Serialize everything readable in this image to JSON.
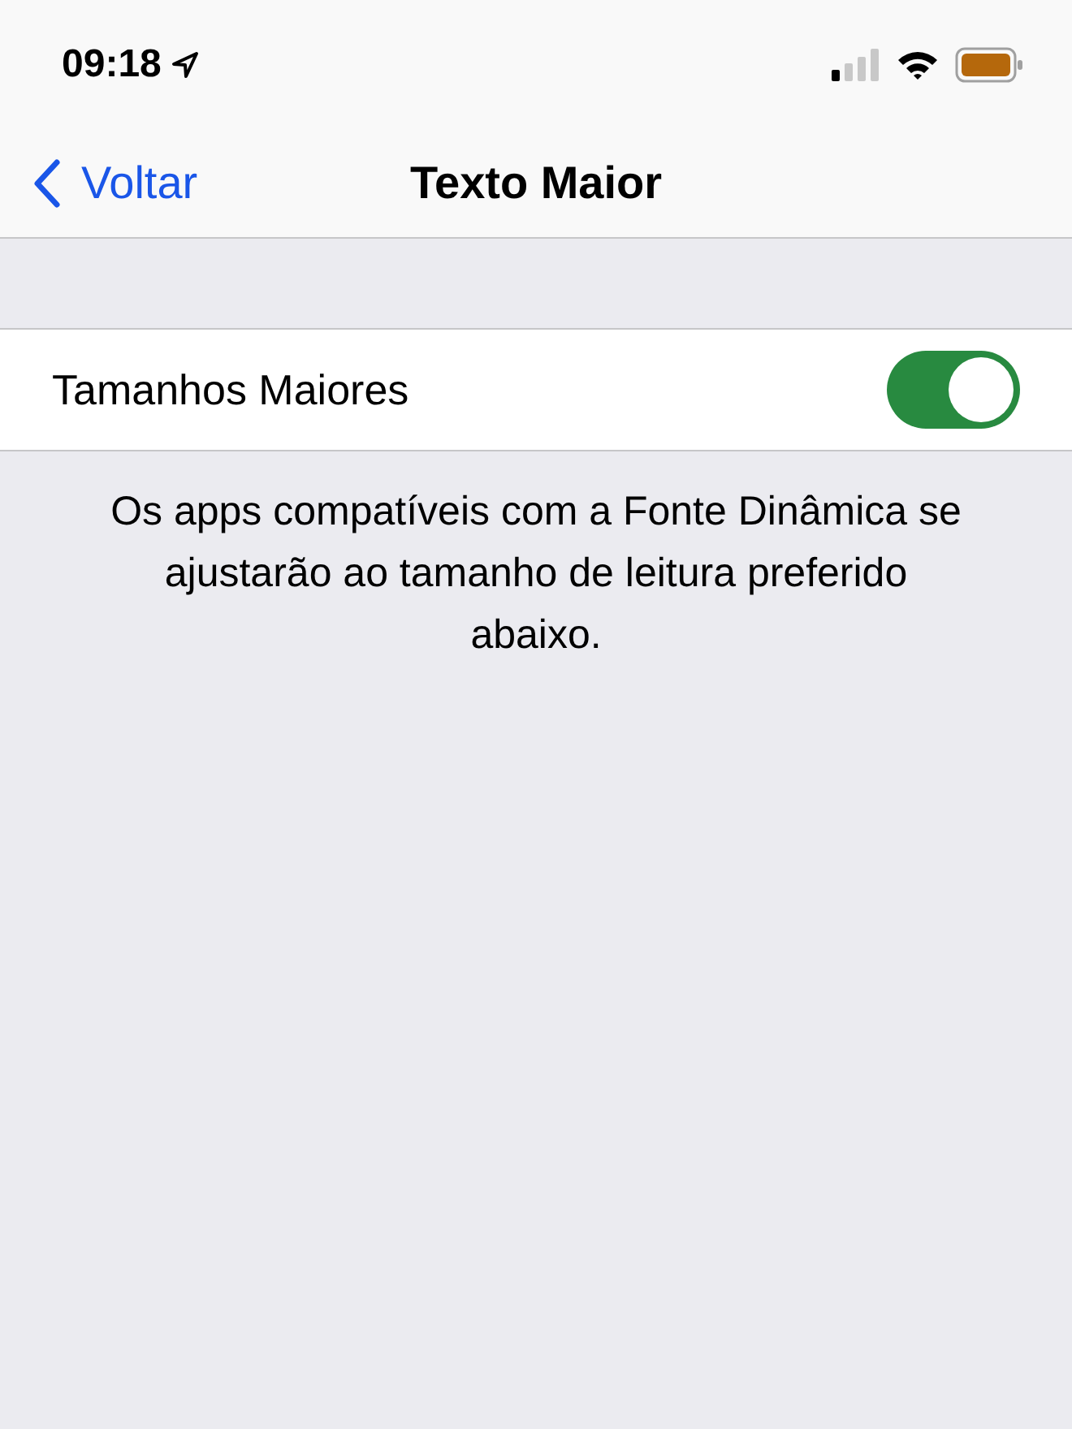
{
  "status_bar": {
    "time": "09:18"
  },
  "nav_bar": {
    "back": "Voltar",
    "title": "Texto Maior"
  },
  "settings": [
    {
      "label": "Tamanhos Maiores",
      "on": true
    }
  ],
  "footer": "Os apps compatíveis com a Fonte Dinâmica se ajustarão ao tamanho de leitura preferido abaixo."
}
